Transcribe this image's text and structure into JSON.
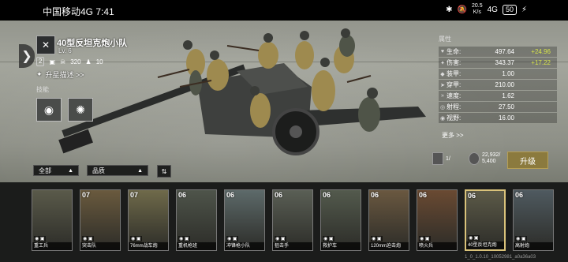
{
  "status_bar": {
    "carrier": "中国移动4G 7:41",
    "speed_value": "20.5",
    "speed_unit": "K/s",
    "signal": "4G",
    "battery": "50"
  },
  "squad": {
    "name": "40型反坦克炮小队",
    "level": "Lv. 6",
    "badge_count": "2",
    "power_a": "320",
    "power_b": "10",
    "upgrade_desc": "升星描述 >>",
    "skills_label": "技能"
  },
  "attributes": {
    "title": "属性",
    "rows": [
      {
        "icon": "heart-icon",
        "name": "生命:",
        "value": "497.64",
        "bonus": "+24.96"
      },
      {
        "icon": "damage-icon",
        "name": "伤害:",
        "value": "343.37",
        "bonus": "+17.22"
      },
      {
        "icon": "armor-icon",
        "name": "装甲:",
        "value": "1.00",
        "bonus": ""
      },
      {
        "icon": "pierce-icon",
        "name": "穿甲:",
        "value": "210.00",
        "bonus": ""
      },
      {
        "icon": "speed-icon",
        "name": "速度:",
        "value": "1.62",
        "bonus": ""
      },
      {
        "icon": "range-icon",
        "name": "射程:",
        "value": "27.50",
        "bonus": ""
      },
      {
        "icon": "vision-icon",
        "name": "视野:",
        "value": "16.00",
        "bonus": ""
      }
    ],
    "more": "更多 >>"
  },
  "resources": {
    "fragments": "1/",
    "gold": "22,932/",
    "gold_sub": "5,400",
    "upgrade_label": "升级"
  },
  "filters": {
    "all": "全部",
    "quality": "品质"
  },
  "cards": [
    {
      "level": "",
      "name": "重工兵",
      "selected": false
    },
    {
      "level": "07",
      "name": "突击队",
      "selected": false
    },
    {
      "level": "07",
      "name": "76mm战车炮",
      "selected": false
    },
    {
      "level": "06",
      "name": "重机枪班",
      "selected": false
    },
    {
      "level": "06",
      "name": "冲锋枪小队",
      "selected": false
    },
    {
      "level": "06",
      "name": "狙击手",
      "selected": false
    },
    {
      "level": "06",
      "name": "救护车",
      "selected": false
    },
    {
      "level": "06",
      "name": "120mm迫击炮",
      "selected": false
    },
    {
      "level": "06",
      "name": "喷火兵",
      "selected": false
    },
    {
      "level": "06",
      "name": "40型反坦克炮",
      "selected": true
    },
    {
      "level": "06",
      "name": "高射炮",
      "selected": false
    }
  ],
  "version": "1_0_1.0.10_10052981_a0a36a03"
}
